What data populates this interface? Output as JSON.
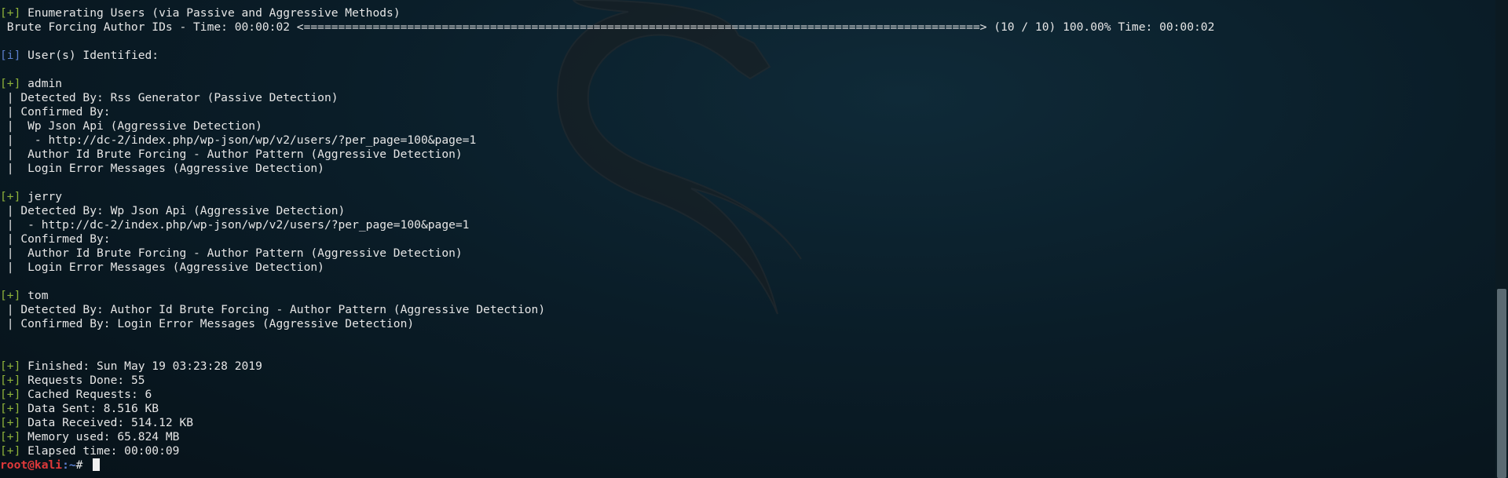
{
  "terminal": {
    "lines": [
      {
        "tag": "[+]",
        "text": " Enumerating Users (via Passive and Aggressive Methods)"
      },
      {
        "tag": "",
        "text": " Brute Forcing Author IDs - Time: 00:00:02 <==================================================================================================> (10 / 10) 100.00% Time: 00:00:02"
      },
      {
        "tag": "",
        "text": ""
      },
      {
        "tag": "[i]",
        "text": " User(s) Identified:"
      },
      {
        "tag": "",
        "text": ""
      },
      {
        "tag": "[+]",
        "text": " admin"
      },
      {
        "tag": "",
        "text": " | Detected By: Rss Generator (Passive Detection)"
      },
      {
        "tag": "",
        "text": " | Confirmed By:"
      },
      {
        "tag": "",
        "text": " |  Wp Json Api (Aggressive Detection)"
      },
      {
        "tag": "",
        "text": " |   - http://dc-2/index.php/wp-json/wp/v2/users/?per_page=100&page=1"
      },
      {
        "tag": "",
        "text": " |  Author Id Brute Forcing - Author Pattern (Aggressive Detection)"
      },
      {
        "tag": "",
        "text": " |  Login Error Messages (Aggressive Detection)"
      },
      {
        "tag": "",
        "text": ""
      },
      {
        "tag": "[+]",
        "text": " jerry"
      },
      {
        "tag": "",
        "text": " | Detected By: Wp Json Api (Aggressive Detection)"
      },
      {
        "tag": "",
        "text": " |  - http://dc-2/index.php/wp-json/wp/v2/users/?per_page=100&page=1"
      },
      {
        "tag": "",
        "text": " | Confirmed By:"
      },
      {
        "tag": "",
        "text": " |  Author Id Brute Forcing - Author Pattern (Aggressive Detection)"
      },
      {
        "tag": "",
        "text": " |  Login Error Messages (Aggressive Detection)"
      },
      {
        "tag": "",
        "text": ""
      },
      {
        "tag": "[+]",
        "text": " tom"
      },
      {
        "tag": "",
        "text": " | Detected By: Author Id Brute Forcing - Author Pattern (Aggressive Detection)"
      },
      {
        "tag": "",
        "text": " | Confirmed By: Login Error Messages (Aggressive Detection)"
      },
      {
        "tag": "",
        "text": ""
      },
      {
        "tag": "",
        "text": ""
      },
      {
        "tag": "[+]",
        "text": " Finished: Sun May 19 03:23:28 2019"
      },
      {
        "tag": "[+]",
        "text": " Requests Done: 55"
      },
      {
        "tag": "[+]",
        "text": " Cached Requests: 6"
      },
      {
        "tag": "[+]",
        "text": " Data Sent: 8.516 KB"
      },
      {
        "tag": "[+]",
        "text": " Data Received: 514.12 KB"
      },
      {
        "tag": "[+]",
        "text": " Memory used: 65.824 MB"
      },
      {
        "tag": "[+]",
        "text": " Elapsed time: 00:00:09"
      }
    ],
    "prompt": {
      "user_host": "root@kali",
      "path": ":~",
      "symbol": "# "
    }
  },
  "colors": {
    "plus_tag": "#8fb33a",
    "info_tag": "#5c7fcf",
    "prompt_user": "#e0393a",
    "prompt_path": "#5c7fcf",
    "text": "#e6e6e6"
  },
  "icons": {
    "background": "kali-dragon-icon",
    "cursor": "block-cursor"
  }
}
